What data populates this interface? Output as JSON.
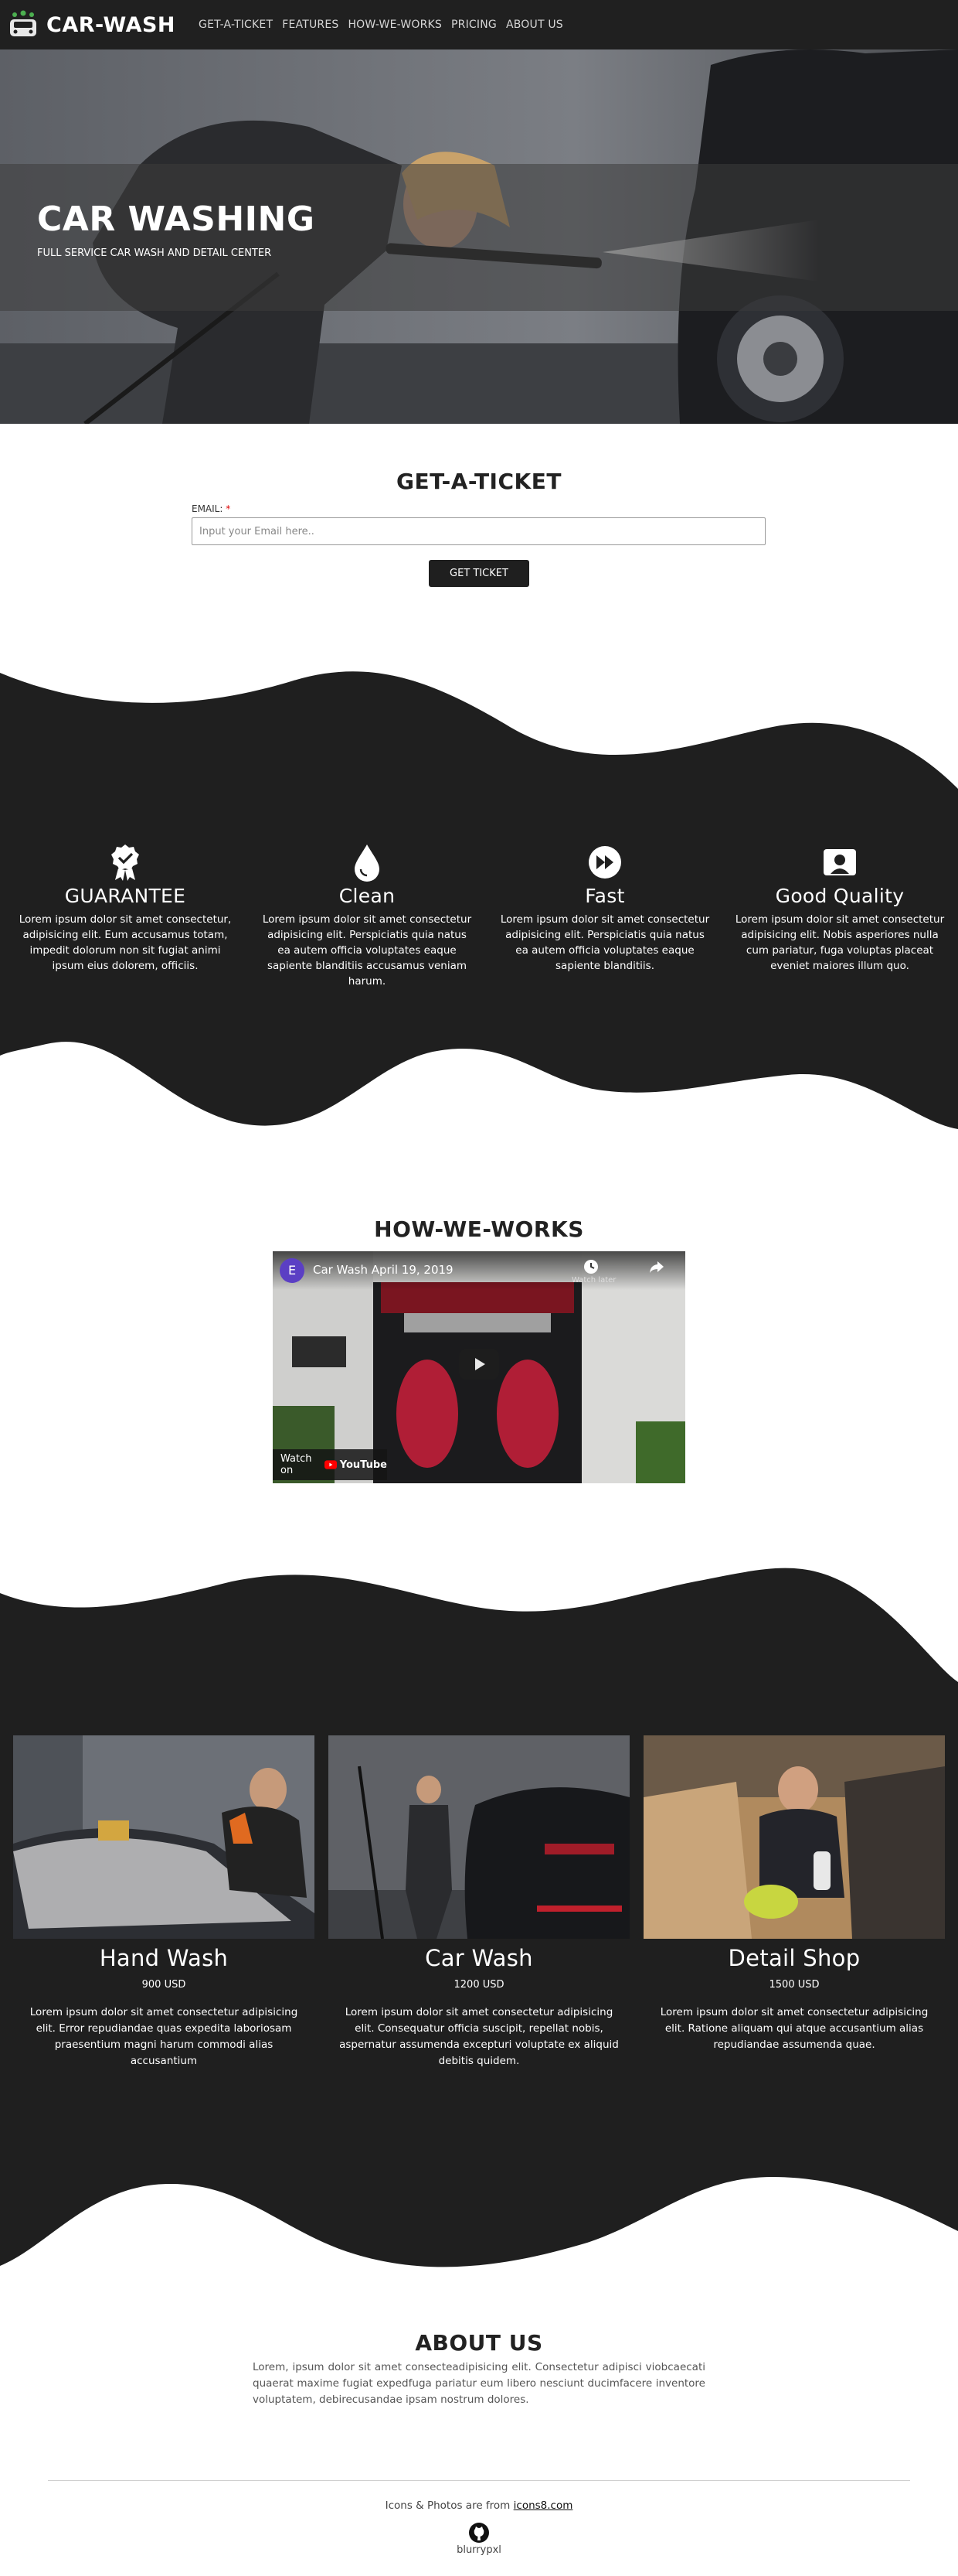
{
  "nav": {
    "brand": "CAR-WASH",
    "links": [
      "GET-A-TICKET",
      "FEATURES",
      "HOW-WE-WORKS",
      "PRICING",
      "ABOUT US"
    ]
  },
  "hero": {
    "title": "CAR WASHING",
    "subtitle": "FULL SERVICE CAR WASH AND DETAIL CENTER"
  },
  "ticket": {
    "title": "GET-A-TICKET",
    "email_label": "EMAIL:",
    "required_mark": "*",
    "email_placeholder": "Input your Email here..",
    "email_value": "",
    "button": "GET TICKET"
  },
  "features": [
    {
      "icon": "award-badge-icon",
      "title": "GUARANTEE",
      "text": "Lorem ipsum dolor sit amet consectetur, adipisicing elit. Eum accusamus totam, impedit dolorum non sit fugiat animi ipsum eius dolorem, officiis."
    },
    {
      "icon": "water-drop-icon",
      "title": "Clean",
      "text": "Lorem ipsum dolor sit amet consectetur adipisicing elit. Perspiciatis quia natus ea autem officia voluptates eaque sapiente blanditiis accusamus veniam harum."
    },
    {
      "icon": "fast-forward-icon",
      "title": "Fast",
      "text": "Lorem ipsum dolor sit amet consectetur adipisicing elit. Perspiciatis quia natus ea autem officia voluptates eaque sapiente blanditiis."
    },
    {
      "icon": "quality-certificate-icon",
      "title": "Good Quality",
      "text": "Lorem ipsum dolor sit amet consectetur adipisicing elit. Nobis asperiores nulla cum pariatur, fuga voluptas placeat eveniet maiores illum quo."
    }
  ],
  "how": {
    "title": "HOW-WE-WORKS",
    "video": {
      "channel_initial": "E",
      "title": "Car Wash April 19, 2019",
      "watch_later": "Watch later",
      "watch_on": "Watch on",
      "platform": "YouTube"
    }
  },
  "services": [
    {
      "name": "Hand Wash",
      "price": "900 USD",
      "text": "Lorem ipsum dolor sit amet consectetur adipisicing elit. Error repudiandae quas expedita laboriosam praesentium magni harum commodi alias accusantium"
    },
    {
      "name": "Car Wash",
      "price": "1200 USD",
      "text": "Lorem ipsum dolor sit amet consectetur adipisicing elit. Consequatur officia suscipit, repellat nobis, aspernatur assumenda excepturi voluptate ex aliquid debitis quidem."
    },
    {
      "name": "Detail Shop",
      "price": "1500 USD",
      "text": "Lorem ipsum dolor sit amet consectetur adipisicing elit. Ratione aliquam qui atque accusantium alias repudiandae assumenda quae."
    }
  ],
  "about": {
    "title": "ABOUT US",
    "text": "Lorem, ipsum dolor sit amet consecteadipisicing elit. Consectetur adipisci viobcaecati quaerat maxime fugiat expedfuga pariatur eum libero nesciunt ducimfacere inventore voluptatem, debirecusandae ipsam nostrum dolores."
  },
  "footer": {
    "credit_prefix": "Icons & Photos are from",
    "credit_link": "icons8.com",
    "user": "blurrypxl"
  },
  "colors": {
    "dark": "#202020",
    "section_dark": "#1f1f1f",
    "text_light": "#ffffff"
  }
}
